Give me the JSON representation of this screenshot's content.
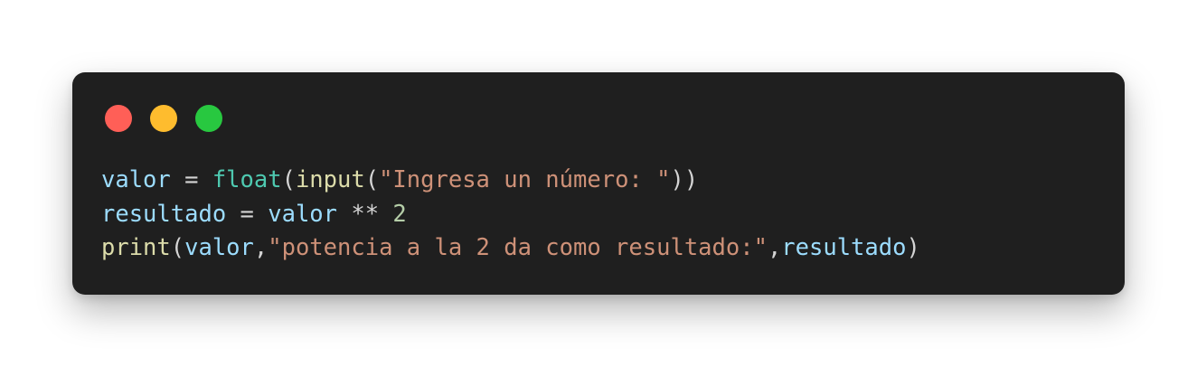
{
  "window": {
    "controls": [
      {
        "name": "close",
        "color": "#ff5f57"
      },
      {
        "name": "minimize",
        "color": "#febc2e"
      },
      {
        "name": "maximize",
        "color": "#28c840"
      }
    ]
  },
  "colors": {
    "background": "#1f1f1f",
    "variable": "#9cdcfe",
    "operator": "#d4d4d4",
    "builtin": "#4ec9b0",
    "function": "#dcdcaa",
    "string": "#ce9178",
    "number": "#b5cea8",
    "punctuation": "#d4d4d4"
  },
  "code_lines": [
    [
      {
        "text": "valor",
        "kind": "variable"
      },
      {
        "text": " = ",
        "kind": "operator"
      },
      {
        "text": "float",
        "kind": "builtin"
      },
      {
        "text": "(",
        "kind": "punctuation"
      },
      {
        "text": "input",
        "kind": "function"
      },
      {
        "text": "(",
        "kind": "punctuation"
      },
      {
        "text": "\"Ingresa un número: \"",
        "kind": "string"
      },
      {
        "text": "))",
        "kind": "punctuation"
      }
    ],
    [
      {
        "text": "resultado",
        "kind": "variable"
      },
      {
        "text": " = ",
        "kind": "operator"
      },
      {
        "text": "valor",
        "kind": "variable"
      },
      {
        "text": " ** ",
        "kind": "operator"
      },
      {
        "text": "2",
        "kind": "number"
      }
    ],
    [
      {
        "text": "print",
        "kind": "function"
      },
      {
        "text": "(",
        "kind": "punctuation"
      },
      {
        "text": "valor",
        "kind": "variable"
      },
      {
        "text": ",",
        "kind": "punctuation"
      },
      {
        "text": "\"potencia a la 2 da como resultado:\"",
        "kind": "string"
      },
      {
        "text": ",",
        "kind": "punctuation"
      },
      {
        "text": "resultado",
        "kind": "variable"
      },
      {
        "text": ")",
        "kind": "punctuation"
      }
    ]
  ]
}
